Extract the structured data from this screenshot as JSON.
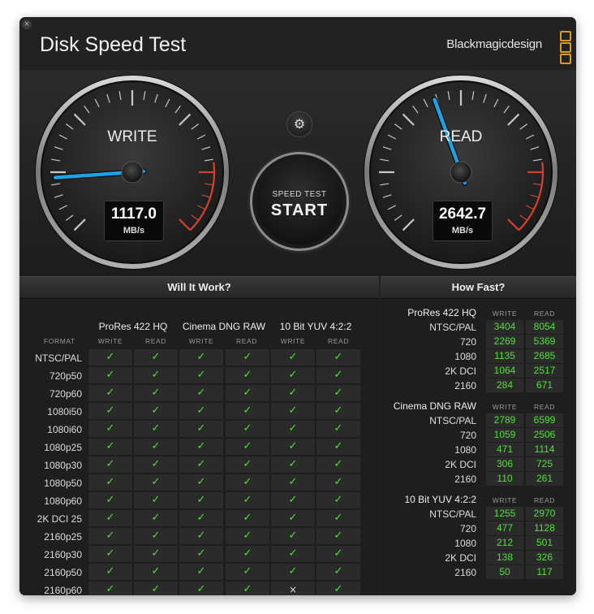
{
  "window": {
    "title": "Disk Speed Test",
    "brand": "Blackmagicdesign",
    "close_glyph": "×"
  },
  "colors": {
    "accent_green": "#52e039",
    "needle_blue": "#1aa3e6",
    "redline": "#d6402e",
    "logo_orange": "#d89a2a"
  },
  "gauges": {
    "write": {
      "label": "WRITE",
      "value": "1117.0",
      "unit": "MB/s",
      "needle_angle_deg": -94
    },
    "read": {
      "label": "READ",
      "value": "2642.7",
      "unit": "MB/s",
      "needle_angle_deg": -20
    }
  },
  "controls": {
    "settings_icon": "⚙",
    "start_small": "SPEED TEST",
    "start_big": "START"
  },
  "will_it_work": {
    "title": "Will It Work?",
    "format_header": "FORMAT",
    "codecs": [
      {
        "name": "ProRes 422 HQ",
        "write": "WRITE",
        "read": "READ"
      },
      {
        "name": "Cinema DNG RAW",
        "write": "WRITE",
        "read": "READ"
      },
      {
        "name": "10 Bit YUV 4:2:2",
        "write": "WRITE",
        "read": "READ"
      }
    ],
    "check_glyph": "✓",
    "fail_glyph": "×",
    "rows": [
      {
        "format": "NTSC/PAL",
        "ok": [
          true,
          true,
          true,
          true,
          true,
          true
        ]
      },
      {
        "format": "720p50",
        "ok": [
          true,
          true,
          true,
          true,
          true,
          true
        ]
      },
      {
        "format": "720p60",
        "ok": [
          true,
          true,
          true,
          true,
          true,
          true
        ]
      },
      {
        "format": "1080i50",
        "ok": [
          true,
          true,
          true,
          true,
          true,
          true
        ]
      },
      {
        "format": "1080i60",
        "ok": [
          true,
          true,
          true,
          true,
          true,
          true
        ]
      },
      {
        "format": "1080p25",
        "ok": [
          true,
          true,
          true,
          true,
          true,
          true
        ]
      },
      {
        "format": "1080p30",
        "ok": [
          true,
          true,
          true,
          true,
          true,
          true
        ]
      },
      {
        "format": "1080p50",
        "ok": [
          true,
          true,
          true,
          true,
          true,
          true
        ]
      },
      {
        "format": "1080p60",
        "ok": [
          true,
          true,
          true,
          true,
          true,
          true
        ]
      },
      {
        "format": "2K DCI 25",
        "ok": [
          true,
          true,
          true,
          true,
          true,
          true
        ]
      },
      {
        "format": "2160p25",
        "ok": [
          true,
          true,
          true,
          true,
          true,
          true
        ]
      },
      {
        "format": "2160p30",
        "ok": [
          true,
          true,
          true,
          true,
          true,
          true
        ]
      },
      {
        "format": "2160p50",
        "ok": [
          true,
          true,
          true,
          true,
          true,
          true
        ]
      },
      {
        "format": "2160p60",
        "ok": [
          true,
          true,
          true,
          true,
          false,
          true
        ]
      }
    ]
  },
  "how_fast": {
    "title": "How Fast?",
    "sections": [
      {
        "name": "ProRes 422 HQ",
        "write": "WRITE",
        "read": "READ",
        "rows": [
          {
            "format": "NTSC/PAL",
            "write": "3404",
            "read": "8054"
          },
          {
            "format": "720",
            "write": "2269",
            "read": "5369"
          },
          {
            "format": "1080",
            "write": "1135",
            "read": "2685"
          },
          {
            "format": "2K DCI",
            "write": "1064",
            "read": "2517"
          },
          {
            "format": "2160",
            "write": "284",
            "read": "671"
          }
        ]
      },
      {
        "name": "Cinema DNG RAW",
        "write": "WRITE",
        "read": "READ",
        "rows": [
          {
            "format": "NTSC/PAL",
            "write": "2789",
            "read": "6599"
          },
          {
            "format": "720",
            "write": "1059",
            "read": "2506"
          },
          {
            "format": "1080",
            "write": "471",
            "read": "1114"
          },
          {
            "format": "2K DCI",
            "write": "306",
            "read": "725"
          },
          {
            "format": "2160",
            "write": "110",
            "read": "261"
          }
        ]
      },
      {
        "name": "10 Bit YUV 4:2:2",
        "write": "WRITE",
        "read": "READ",
        "rows": [
          {
            "format": "NTSC/PAL",
            "write": "1255",
            "read": "2970"
          },
          {
            "format": "720",
            "write": "477",
            "read": "1128"
          },
          {
            "format": "1080",
            "write": "212",
            "read": "501"
          },
          {
            "format": "2K DCI",
            "write": "138",
            "read": "326"
          },
          {
            "format": "2160",
            "write": "50",
            "read": "117"
          }
        ]
      }
    ]
  }
}
